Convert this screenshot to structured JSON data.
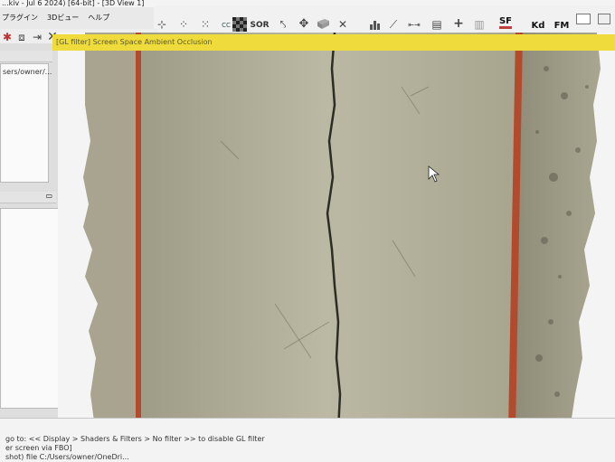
{
  "window": {
    "title": "...kiv - Jul 6 2024) [64-bit] - [3D View 1]"
  },
  "menu": {
    "items": [
      "プラグイン",
      "3Dビュー",
      "ヘルプ"
    ]
  },
  "toolbar": {
    "sor_label": "SOR",
    "sf_label": "SF",
    "kd_label": "Kd",
    "fm_label": "FM",
    "cc_label": "CC",
    "plus_label": "+"
  },
  "overlay": {
    "gl_filter_message": "[GL filter] Screen Space Ambient Occlusion"
  },
  "db_panel": {
    "path": "sers/owner/..."
  },
  "console": {
    "lines": [
      "go to: << Display > Shaders & Filters > No filter >> to disable GL filter",
      "er screen via FBO]",
      "shot) file C:/Users/owner/OneDri..."
    ]
  },
  "colors": {
    "toolbar_bg": "#f1f1f1",
    "filter_bar": "#efdb3c",
    "concrete": "#b9b69f",
    "rebar_red": "#b24a2e",
    "crack": "#2d2c25"
  }
}
